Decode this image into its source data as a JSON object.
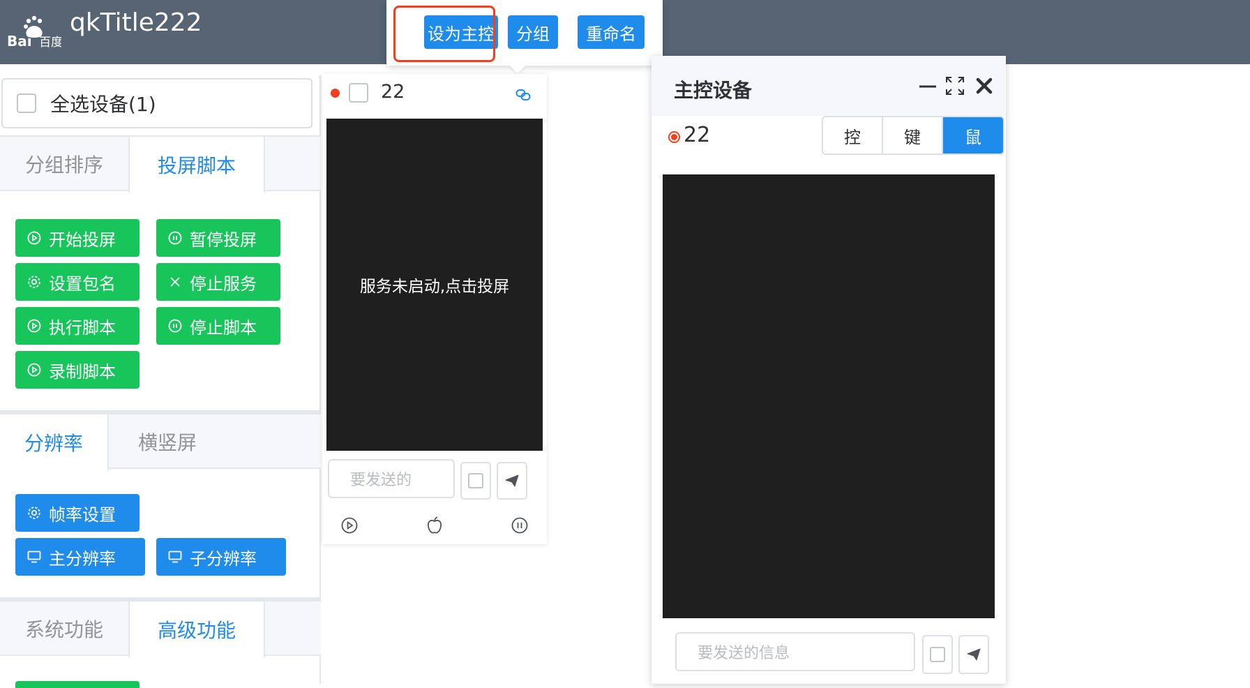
{
  "header": {
    "app_title": "qkTitle222",
    "logo_text": "Bai 百度"
  },
  "popover": {
    "buttons": [
      "设为主控",
      "分组",
      "重命名"
    ]
  },
  "left_panel": {
    "select_all_label": "全选设备(1)",
    "tabs1": {
      "labels": [
        "分组排序",
        "投屏脚本"
      ],
      "active": "投屏脚本"
    },
    "script_buttons": [
      {
        "label": "开始投屏",
        "icon": "play-circle-icon"
      },
      {
        "label": "暂停投屏",
        "icon": "pause-circle-icon"
      },
      {
        "label": "设置包名",
        "icon": "gear-icon"
      },
      {
        "label": "停止服务",
        "icon": "close-icon"
      },
      {
        "label": "执行脚本",
        "icon": "play-circle-icon"
      },
      {
        "label": "停止脚本",
        "icon": "pause-circle-icon"
      },
      {
        "label": "录制脚本",
        "icon": "play-circle-icon"
      }
    ],
    "tabs2": {
      "labels": [
        "分辨率",
        "横竖屏"
      ],
      "active": "分辨率"
    },
    "resolution_buttons": [
      {
        "label": "帧率设置",
        "icon": "gear-icon"
      },
      {
        "label": "主分辨率",
        "icon": "monitor-icon"
      },
      {
        "label": "子分辨率",
        "icon": "monitor-icon"
      }
    ],
    "tabs3": {
      "labels": [
        "系统功能",
        "高级功能"
      ],
      "active": "高级功能"
    }
  },
  "device_card": {
    "name": "22",
    "screen_message": "服务未启动,点击投屏",
    "input_placeholder": "要发送的信息",
    "input_visible_text": "要发送的"
  },
  "master_panel": {
    "title": "主控设备",
    "device_name": "22",
    "segments": [
      "控",
      "键",
      "鼠"
    ],
    "active_segment": "鼠",
    "input_placeholder": "要发送的信息"
  },
  "colors": {
    "header": "#566474",
    "primary": "#1f8ceb",
    "success": "#17c55b",
    "highlight": "#f0411f",
    "screen": "#1f1f1f"
  }
}
